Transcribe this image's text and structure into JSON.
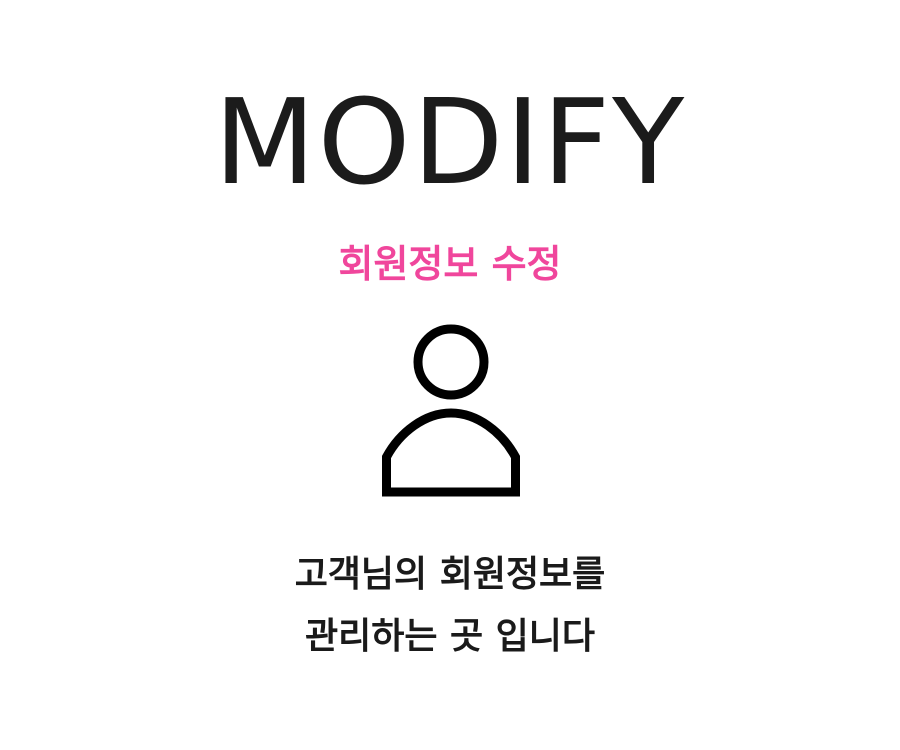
{
  "header": {
    "title": "MODIFY",
    "subtitle": "회원정보 수정"
  },
  "icon": {
    "name": "user-icon"
  },
  "description": {
    "line1": "고객님의 회원정보를",
    "line2": "관리하는 곳 입니다"
  },
  "colors": {
    "title": "#1b1b1b",
    "accent": "#f0469c",
    "text": "#1a1a1a",
    "background": "#ffffff"
  }
}
